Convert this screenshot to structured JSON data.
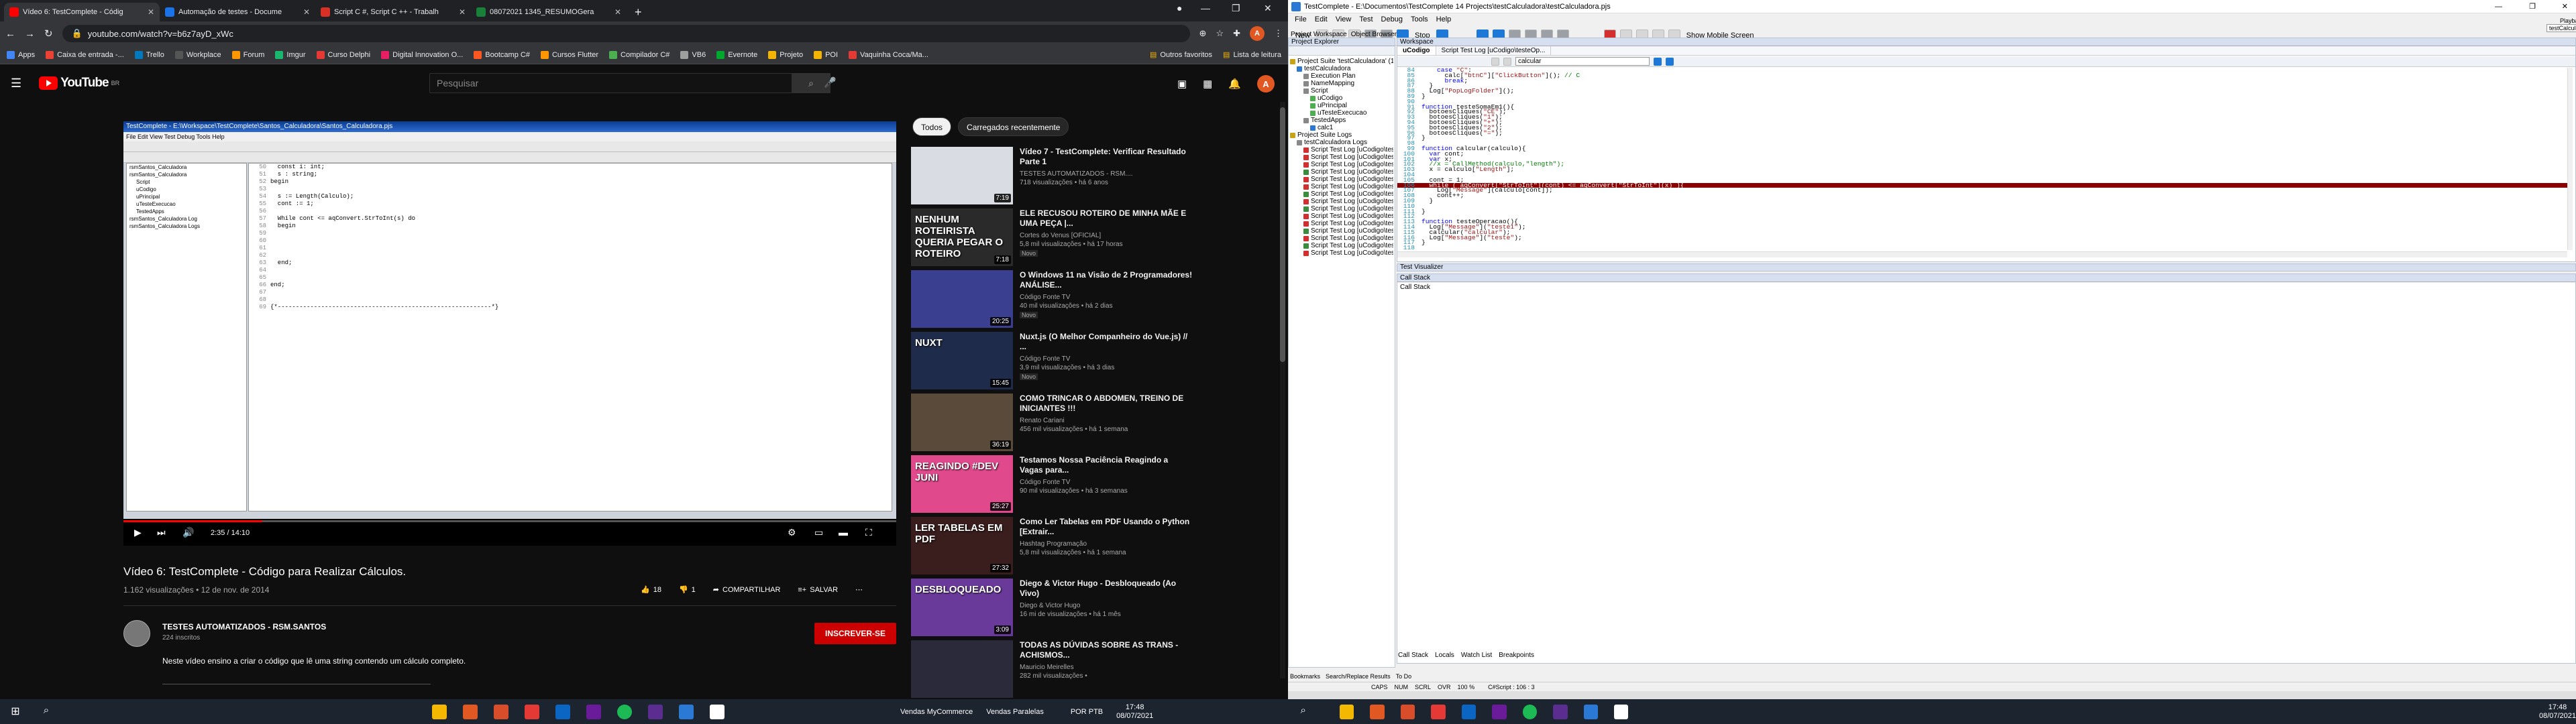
{
  "colors": {
    "youtube_red": "#ff0000",
    "breakpoint": "#8b0000",
    "taskbar": "#1c2430",
    "chrome_dark": "#202124"
  },
  "left": {
    "tabs": [
      {
        "title": "Vídeo 6: TestComplete - Códig",
        "color": "#ff0000"
      },
      {
        "title": "Automação de testes - Docume",
        "color": "#1a73e8"
      },
      {
        "title": "Script C #, Script C ++ - Trabalh",
        "color": "#d93025"
      },
      {
        "title": "08072021 1345_RESUMOGera",
        "color": "#188038"
      }
    ],
    "url": "youtube.com/watch?v=b6z7ayD_xWc",
    "bookmarks": [
      {
        "label": "Apps",
        "color": "#4285f4"
      },
      {
        "label": "Caixa de entrada -...",
        "color": "#ea4335"
      },
      {
        "label": "Trello",
        "color": "#0079bf"
      },
      {
        "label": "Workplace",
        "color": "#555555"
      },
      {
        "label": "Forum",
        "color": "#ff9800"
      },
      {
        "label": "Imgur",
        "color": "#1bb76e"
      },
      {
        "label": "Curso Delphi",
        "color": "#e53935"
      },
      {
        "label": "Digital Innovation O...",
        "color": "#e91e63"
      },
      {
        "label": "Bootcamp C#",
        "color": "#ff5722"
      },
      {
        "label": "Cursos Flutter",
        "color": "#ff9800"
      },
      {
        "label": "Compilador C#",
        "color": "#4caf50"
      },
      {
        "label": "VB6",
        "color": "#9e9e9e"
      },
      {
        "label": "Evernote",
        "color": "#00a82d"
      },
      {
        "label": "Projeto",
        "color": "#f4b400"
      },
      {
        "label": "POI",
        "color": "#f4b400"
      },
      {
        "label": "Vaquinha Coca/Ma...",
        "color": "#e53935"
      }
    ],
    "bookmarks_right": [
      "Outros favoritos",
      "Lista de leitura"
    ],
    "youtube": {
      "logo": "YouTube",
      "logo_sup": "BR",
      "search_placeholder": "Pesquisar",
      "avatar_letter": "A",
      "video": {
        "title": "Vídeo 6: TestComplete - Código para Realizar Cálculos.",
        "meta": "1.162 visualizações • 12 de nov. de 2014",
        "likes": "18",
        "dislikes": "1",
        "share": "COMPARTILHAR",
        "save": "SALVAR",
        "time": "2:35 / 14:10",
        "progress": 0.18
      },
      "channel": {
        "name": "TESTES AUTOMATIZADOS - RSM.SANTOS",
        "subs": "224 inscritos",
        "subscribe": "INSCREVER-SE"
      },
      "description": "Neste vídeo ensino a criar o código que lê uma string contendo um cálculo completo.",
      "chips": [
        "Todos",
        "Carregados recentemente"
      ],
      "recs": [
        {
          "title": "Vídeo 7 - TestComplete: Verificar Resultado Parte 1",
          "channel": "TESTES AUTOMATIZADOS - RSM....",
          "views": "718 visualizações • há 6 anos",
          "duration": "7:19",
          "thumb": "#d9dde3",
          "overlay": "",
          "novo": ""
        },
        {
          "title": "ELE RECUSOU ROTEIRO DE MINHA MÃE E UMA PEÇA |...",
          "channel": "Cortes do Venus [OFICIAL]",
          "views": "5,8 mil visualizações • há 17 horas",
          "duration": "7:18",
          "thumb": "#2a2a2a",
          "overlay": "NENHUM ROTEIRISTA QUERIA PEGAR O ROTEIRO",
          "novo": "Novo"
        },
        {
          "title": "O Windows 11 na Visão de 2 Programadores! ANÁLISE...",
          "channel": "Código Fonte TV",
          "views": "40 mil visualizações • há 2 dias",
          "duration": "20:25",
          "thumb": "#3b3f8f",
          "overlay": "",
          "novo": "Novo"
        },
        {
          "title": "Nuxt.js (O Melhor Companheiro do Vue.js) // ...",
          "channel": "Código Fonte TV",
          "views": "3,9 mil visualizações • há 3 dias",
          "duration": "15:45",
          "thumb": "#1f2b4a",
          "overlay": "NUXT",
          "novo": "Novo"
        },
        {
          "title": "COMO TRINCAR O ABDOMEN, TREINO DE INICIANTES !!!",
          "channel": "Renato Cariani",
          "views": "456 mil visualizações • há 1 semana",
          "duration": "36:19",
          "thumb": "#5a4a3a",
          "overlay": "",
          "novo": ""
        },
        {
          "title": "Testamos Nossa Paciência Reagindo a Vagas para...",
          "channel": "Código Fonte TV",
          "views": "90 mil visualizações • há 3 semanas",
          "duration": "25:27",
          "thumb": "#e04a8c",
          "overlay": "REAGINDO #DEV JUNI",
          "novo": ""
        },
        {
          "title": "Como Ler Tabelas em PDF Usando o Python [Extrair...",
          "channel": "Hashtag Programação",
          "views": "5,8 mil visualizações • há 1 semana",
          "duration": "27:32",
          "thumb": "#3a1d1d",
          "overlay": "LER TABELAS EM PDF",
          "novo": ""
        },
        {
          "title": "Diego & Victor Hugo - Desbloqueado (Ao Vivo)",
          "channel": "Diego & Victor Hugo",
          "views": "16 mi de visualizações • há 1 mês",
          "duration": "3:09",
          "thumb": "#6a3a9a",
          "overlay": "DESBLOQUEADO",
          "novo": ""
        },
        {
          "title": "TODAS AS DÚVIDAS SOBRE AS TRANS - ACHISMOS...",
          "channel": "Mauricio Meirelles",
          "views": "282 mil visualizações •",
          "duration": "",
          "thumb": "#2a2a3a",
          "overlay": "",
          "novo": ""
        }
      ]
    },
    "inner_video": {
      "title": "TestComplete - E:\\Workspace\\TestComplete\\Santos_Calculadora\\Santos_Calculadora.pjs",
      "menu": "File  Edit  View  Test  Debug  Tools  Help",
      "code": [
        {
          "n": "50",
          "t": "  const i: int;"
        },
        {
          "n": "51",
          "t": "  s : string;"
        },
        {
          "n": "52",
          "t": "begin"
        },
        {
          "n": "53",
          "t": ""
        },
        {
          "n": "54",
          "t": "  s := Length(Calculo);"
        },
        {
          "n": "55",
          "t": "  cont := 1;"
        },
        {
          "n": "56",
          "t": ""
        },
        {
          "n": "57",
          "t": "  While cont <= aqConvert.StrToInt(s) do"
        },
        {
          "n": "58",
          "t": "  begin"
        },
        {
          "n": "59",
          "t": ""
        },
        {
          "n": "60",
          "t": ""
        },
        {
          "n": "61",
          "t": ""
        },
        {
          "n": "62",
          "t": ""
        },
        {
          "n": "63",
          "t": "  end;"
        },
        {
          "n": "64",
          "t": ""
        },
        {
          "n": "65",
          "t": ""
        },
        {
          "n": "66",
          "t": "end;"
        },
        {
          "n": "67",
          "t": ""
        },
        {
          "n": "68",
          "t": ""
        },
        {
          "n": "69",
          "t": "{*-----------------------------------------------------------*}"
        }
      ],
      "tree": [
        "rsmSantos_Calculadora",
        "rsmSantos_Calculadora",
        "Script",
        "uCodigo",
        "uPrincipal",
        "uTesteExecucao",
        "TestedApps",
        "rsmSantos_Calculadora Log",
        "rsmSantos_Calculadora Logs"
      ]
    },
    "taskbar": {
      "search": "Vendas MyCommerce",
      "search2": "Vendas Paralelas",
      "lang": "POR PTB",
      "time": "17:48",
      "date": "08/07/2021"
    }
  },
  "right": {
    "title": "TestComplete - E:\\Documentos\\TestComplete 14 Projects\\testCalculadora\\testCalculadora.pjs",
    "menu": [
      "File",
      "Edit",
      "View",
      "Test",
      "Debug",
      "Tools",
      "Help"
    ],
    "toolbar": {
      "new": "New",
      "stop": "Stop",
      "mobile": "Show Mobile Screen"
    },
    "playback": "Playback",
    "playback_tip": "testCalculadora",
    "panel_tabs": [
      "Project Workspace",
      "Object Browser"
    ],
    "project_explorer": "Project Explorer",
    "tree": [
      {
        "label": "Project Suite 'testCalculadora' (1 project",
        "indent": 0,
        "color": "#c8a415"
      },
      {
        "label": "testCalculadora",
        "indent": 1,
        "color": "#2a7ad5"
      },
      {
        "label": "Execution Plan",
        "indent": 2,
        "color": "#888888"
      },
      {
        "label": "NameMapping",
        "indent": 2,
        "color": "#888888"
      },
      {
        "label": "Script",
        "indent": 2,
        "color": "#888888"
      },
      {
        "label": "uCodigo",
        "indent": 3,
        "color": "#4caf50"
      },
      {
        "label": "uPrincipal",
        "indent": 3,
        "color": "#4caf50"
      },
      {
        "label": "uTesteExecucao",
        "indent": 3,
        "color": "#4caf50"
      },
      {
        "label": "TestedApps",
        "indent": 2,
        "color": "#888888"
      },
      {
        "label": "calc1",
        "indent": 3,
        "color": "#2a7ad5"
      },
      {
        "label": "Project Suite Logs",
        "indent": 0,
        "color": "#c8a415"
      },
      {
        "label": "testCalculadora Logs",
        "indent": 1,
        "color": "#888888"
      },
      {
        "label": "Script Test Log [uCodigo\\testeO",
        "indent": 2,
        "color": "#d32f2f"
      },
      {
        "label": "Script Test Log [uCodigo\\testeO",
        "indent": 2,
        "color": "#d32f2f"
      },
      {
        "label": "Script Test Log [uCodigo\\testeO",
        "indent": 2,
        "color": "#d32f2f"
      },
      {
        "label": "Script Test Log [uCodigo\\testeO",
        "indent": 2,
        "color": "#388e3c"
      },
      {
        "label": "Script Test Log [uCodigo\\testeO",
        "indent": 2,
        "color": "#d32f2f"
      },
      {
        "label": "Script Test Log [uCodigo\\testeO",
        "indent": 2,
        "color": "#d32f2f"
      },
      {
        "label": "Script Test Log [uCodigo\\testeO",
        "indent": 2,
        "color": "#388e3c"
      },
      {
        "label": "Script Test Log [uCodigo\\testeO",
        "indent": 2,
        "color": "#d32f2f"
      },
      {
        "label": "Script Test Log [uCodigo\\testeO",
        "indent": 2,
        "color": "#388e3c"
      },
      {
        "label": "Script Test Log [uCodigo\\testeO",
        "indent": 2,
        "color": "#d32f2f"
      },
      {
        "label": "Script Test Log [uCodigo\\testeO",
        "indent": 2,
        "color": "#d32f2f"
      },
      {
        "label": "Script Test Log [uCodigo\\testeO",
        "indent": 2,
        "color": "#388e3c"
      },
      {
        "label": "Script Test Log [uCodigo\\testeO",
        "indent": 2,
        "color": "#d32f2f"
      },
      {
        "label": "Script Test Log [uCodigo\\testeO",
        "indent": 2,
        "color": "#388e3c"
      },
      {
        "label": "Script Test Log [uCodigo\\testeO",
        "indent": 2,
        "color": "#d32f2f"
      }
    ],
    "workspace_title": "Workspace",
    "editor_tabs": [
      "uCodigo",
      "Script Test Log [uCodigo\\testeOp..."
    ],
    "function_select": "calcular",
    "code": [
      {
        "n": "84",
        "html": "    <span class='kw'>case</span> <span class='st'>\"C\"</span>:"
      },
      {
        "n": "85",
        "html": "      calc[<span class='st'>\"btnC\"</span>][<span class='st'>\"ClickButton\"</span>](); <span class='cm'>// C</span>"
      },
      {
        "n": "86",
        "html": "      <span class='kw'>break</span>;"
      },
      {
        "n": "87",
        "html": "  }"
      },
      {
        "n": "88",
        "html": "  Log[<span class='st'>\"PopLogFolder\"</span>]();"
      },
      {
        "n": "89",
        "html": "}"
      },
      {
        "n": "90",
        "html": ""
      },
      {
        "n": "91",
        "html": "<span class='kw'>function</span> testeSomaEm1(){"
      },
      {
        "n": "92",
        "html": "  botoesCliques(<span class='st'>\"CE\"</span>);"
      },
      {
        "n": "93",
        "html": "  botoesCliques(<span class='st'>\"1\"</span>);"
      },
      {
        "n": "94",
        "html": "  botoesCliques(<span class='st'>\"+\"</span>);"
      },
      {
        "n": "95",
        "html": "  botoesCliques(<span class='st'>\"2\"</span>);"
      },
      {
        "n": "96",
        "html": "  botoesCliques(<span class='st'>\"=\"</span>);"
      },
      {
        "n": "97",
        "html": "}"
      },
      {
        "n": "98",
        "html": ""
      },
      {
        "n": "99",
        "html": "<span class='kw'>function</span> calcular(calculo){"
      },
      {
        "n": "100",
        "html": "  <span class='kw'>var</span> cont;"
      },
      {
        "n": "101",
        "html": "  <span class='kw'>var</span> x;"
      },
      {
        "n": "102",
        "html": "  <span class='cm'>//x = CallMethod(calculo,\"length\");</span>"
      },
      {
        "n": "103",
        "html": "  x = calculo[<span class='st'>\"Length\"</span>];"
      },
      {
        "n": "104",
        "html": ""
      },
      {
        "n": "105",
        "html": "  cont = 1;"
      },
      {
        "n": "106",
        "html": "  while ( aqConvert[\"StrToInt\"](cont) <= aqConvert[\"StrToInt\"](x) ){",
        "bp": true
      },
      {
        "n": "107",
        "html": "    Log[<span class='st'>\"Message\"</span>](calculo[cont]);"
      },
      {
        "n": "108",
        "html": "    cont++;"
      },
      {
        "n": "109",
        "html": "  }"
      },
      {
        "n": "110",
        "html": ""
      },
      {
        "n": "111",
        "html": "}"
      },
      {
        "n": "112",
        "html": ""
      },
      {
        "n": "113",
        "html": "<span class='kw'>function</span> testeOperacao(){"
      },
      {
        "n": "114",
        "html": "  Log[<span class='st'>\"Message\"</span>](<span class='st'>\"teste1\"</span>);"
      },
      {
        "n": "115",
        "html": "  calcular(<span class='st'>\"calcular\"</span>);"
      },
      {
        "n": "116",
        "html": "  Log[<span class='st'>\"Message\"</span>](<span class='st'>\"teste\"</span>);"
      },
      {
        "n": "117",
        "html": "}"
      },
      {
        "n": "118",
        "html": ""
      }
    ],
    "watch_title": "Test Visualizer",
    "callstack_title": "Call Stack",
    "callstack_body": "Call Stack",
    "bottom_tabs": [
      "Call Stack",
      "Locals",
      "Watch List",
      "Breakpoints"
    ],
    "left_bottom_tabs": [
      "Bookmarks",
      "Search/Replace Results",
      "To Do"
    ],
    "status": {
      "caps": "CAPS",
      "num": "NUM",
      "scrl": "SCRL",
      "ovr": "OVR",
      "zoom": "100 %",
      "pos": "C#Script : 106 : 3"
    },
    "taskbar": {
      "time": "17:48",
      "date": "08/07/2021"
    }
  }
}
